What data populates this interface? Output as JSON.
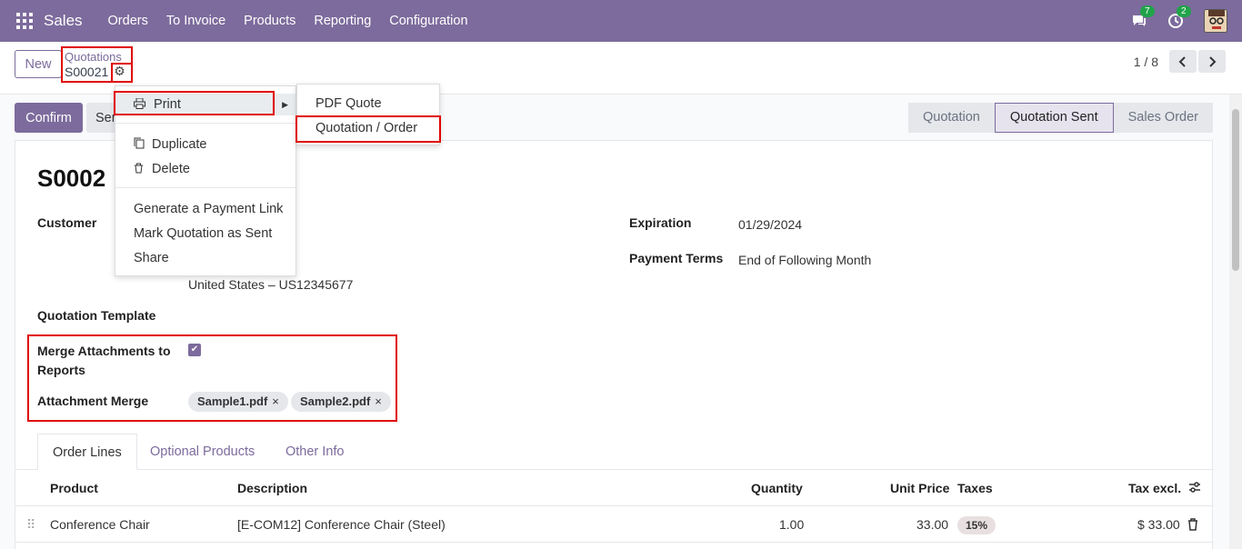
{
  "topbar": {
    "app_name": "Sales",
    "nav": [
      "Orders",
      "To Invoice",
      "Products",
      "Reporting",
      "Configuration"
    ],
    "messages_count": "7",
    "activities_count": "2",
    "accent_color": "#7c6b9c"
  },
  "control": {
    "new_label": "New",
    "breadcrumb_parent": "Quotations",
    "breadcrumb_current": "S00021",
    "pager": "1 / 8"
  },
  "actions": {
    "confirm_label": "Confirm",
    "send_label": "Sen"
  },
  "status": [
    "Quotation",
    "Quotation Sent",
    "Sales Order"
  ],
  "status_active": "Quotation Sent",
  "menu": {
    "print": "Print",
    "duplicate": "Duplicate",
    "delete": "Delete",
    "payment_link": "Generate a Payment Link",
    "mark_sent": "Mark Quotation as Sent",
    "share": "Share"
  },
  "print_submenu": [
    "PDF Quote",
    "Quotation / Order"
  ],
  "form": {
    "title": "S0002",
    "customer_label": "Customer",
    "customer_address_line": "United States – US12345677",
    "expiration_label": "Expiration",
    "expiration_value": "01/29/2024",
    "payment_terms_label": "Payment Terms",
    "payment_terms_value": "End of Following Month",
    "template_label": "Quotation Template",
    "merge_label_1": "Merge Attachments to",
    "merge_label_2": "Reports",
    "merge_checked": true,
    "attachment_label": "Attachment Merge",
    "attachments": [
      "Sample1.pdf",
      "Sample2.pdf"
    ]
  },
  "tabs": [
    "Order Lines",
    "Optional Products",
    "Other Info"
  ],
  "table": {
    "headers": [
      "Product",
      "Description",
      "Quantity",
      "Unit Price",
      "Taxes",
      "Tax excl."
    ],
    "rows": [
      {
        "product": "Conference Chair",
        "description": "[E-COM12] Conference Chair (Steel)",
        "quantity": "1.00",
        "unit_price": "33.00",
        "taxes": "15%",
        "subtotal": "$ 33.00"
      }
    ]
  }
}
